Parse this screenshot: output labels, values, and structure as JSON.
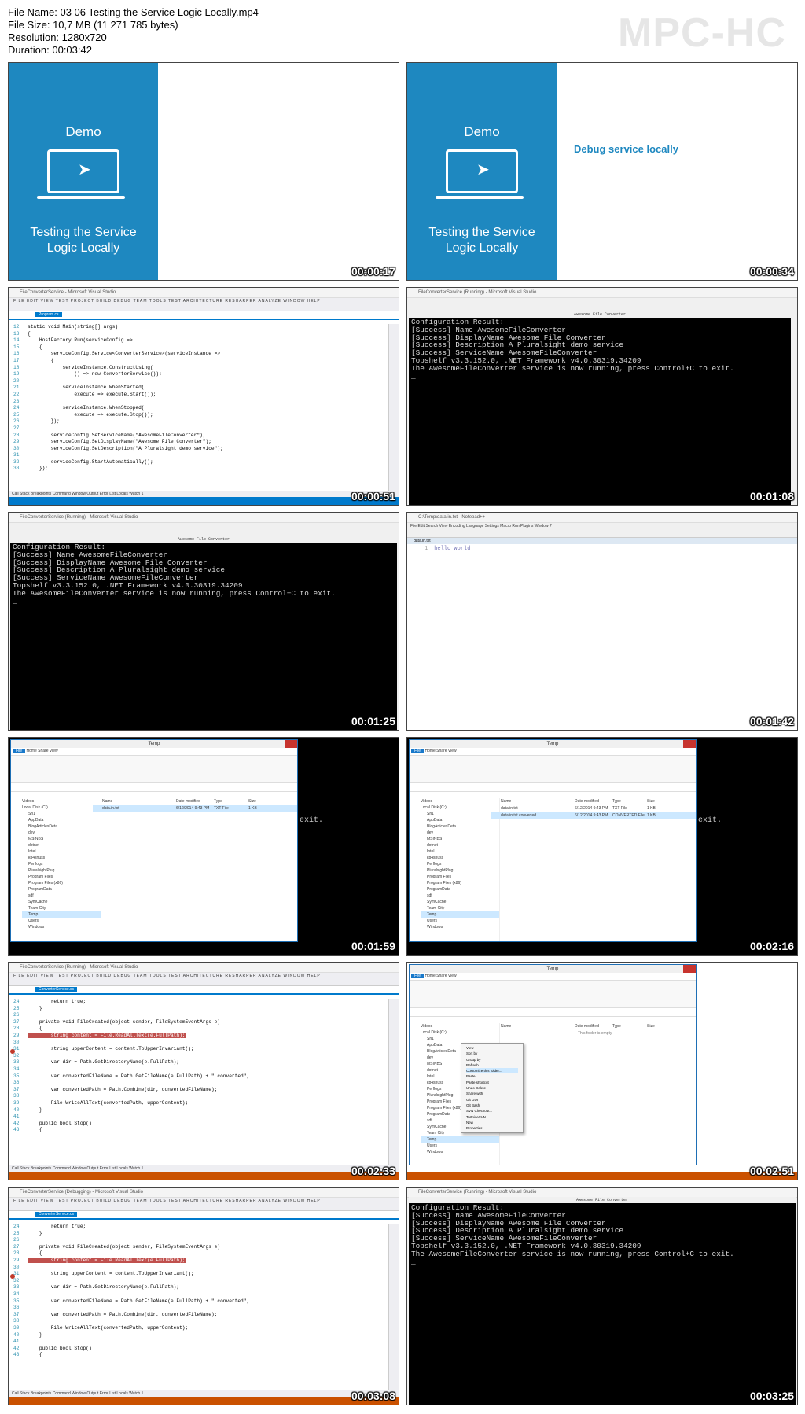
{
  "header": {
    "file_name": "File Name: 03 06 Testing the Service Logic Locally.mp4",
    "file_size": "File Size: 10,7 MB (11 271 785 bytes)",
    "resolution": "Resolution: 1280x720",
    "duration": "Duration: 00:03:42",
    "logo": "MPC-HC"
  },
  "slide": {
    "demo_label": "Demo",
    "title_line1": "Testing the Service",
    "title_line2": "Logic Locally",
    "subtitle": "Debug service locally"
  },
  "timestamps": [
    "00:00:17",
    "00:00:34",
    "00:00:51",
    "00:01:08",
    "00:01:25",
    "00:01:42",
    "00:01:59",
    "00:02:16",
    "00:02:33",
    "00:02:51",
    "00:03:08",
    "00:03:25"
  ],
  "vs": {
    "title": "FileConverterService - Microsoft Visual Studio",
    "title_running": "FileConverterService (Running) - Microsoft Visual Studio",
    "title_debugging": "FileConverterService (Debugging) - Microsoft Visual Studio",
    "menu": "FILE  EDIT  VIEW  TEST  PROJECT  BUILD  DEBUG  TEAM  TOOLS  TEST  ARCHITECTURE  RESHARPER  ANALYZE  WINDOW  HELP",
    "tab_program": "Program.cs",
    "tab_converter": "ConverterService.cs",
    "panel_tabs": "Call Stack  Breakpoints  Command Window  Output  Error List  Locals  Watch 1",
    "program_lines": [
      {
        "n": "12",
        "t": "static void Main(string[] args)"
      },
      {
        "n": "13",
        "t": "{"
      },
      {
        "n": "14",
        "t": "    HostFactory.Run(serviceConfig =>"
      },
      {
        "n": "15",
        "t": "    {"
      },
      {
        "n": "16",
        "t": "        serviceConfig.Service<ConverterService>(serviceInstance =>"
      },
      {
        "n": "17",
        "t": "        {"
      },
      {
        "n": "18",
        "t": "            serviceInstance.ConstructUsing("
      },
      {
        "n": "19",
        "t": "                () => new ConverterService());"
      },
      {
        "n": "20",
        "t": ""
      },
      {
        "n": "21",
        "t": "            serviceInstance.WhenStarted("
      },
      {
        "n": "22",
        "t": "                execute => execute.Start());"
      },
      {
        "n": "23",
        "t": ""
      },
      {
        "n": "24",
        "t": "            serviceInstance.WhenStopped("
      },
      {
        "n": "25",
        "t": "                execute => execute.Stop());"
      },
      {
        "n": "26",
        "t": "        });"
      },
      {
        "n": "27",
        "t": ""
      },
      {
        "n": "28",
        "t": "        serviceConfig.SetServiceName(\"AwesomeFileConverter\");"
      },
      {
        "n": "29",
        "t": "        serviceConfig.SetDisplayName(\"Awesome File Converter\");"
      },
      {
        "n": "30",
        "t": "        serviceConfig.SetDescription(\"A Pluralsight demo service\");"
      },
      {
        "n": "31",
        "t": ""
      },
      {
        "n": "32",
        "t": "        serviceConfig.StartAutomatically();"
      },
      {
        "n": "33",
        "t": "    });"
      }
    ],
    "converter_lines": [
      {
        "n": "24",
        "t": "        return true;"
      },
      {
        "n": "25",
        "t": "    }"
      },
      {
        "n": "26",
        "t": ""
      },
      {
        "n": "27",
        "t": "    private void FileCreated(object sender, FileSystemEventArgs e)"
      },
      {
        "n": "28",
        "t": "    {"
      },
      {
        "n": "29",
        "t": "        string content = File.ReadAllText(e.FullPath);"
      },
      {
        "n": "30",
        "t": ""
      },
      {
        "n": "31",
        "t": "        string upperContent = content.ToUpperInvariant();"
      },
      {
        "n": "32",
        "t": ""
      },
      {
        "n": "33",
        "t": "        var dir = Path.GetDirectoryName(e.FullPath);"
      },
      {
        "n": "34",
        "t": ""
      },
      {
        "n": "35",
        "t": "        var convertedFileName = Path.GetFileName(e.FullPath) + \".converted\";"
      },
      {
        "n": "36",
        "t": ""
      },
      {
        "n": "37",
        "t": "        var convertedPath = Path.Combine(dir, convertedFileName);"
      },
      {
        "n": "38",
        "t": ""
      },
      {
        "n": "39",
        "t": "        File.WriteAllText(convertedPath, upperContent);"
      },
      {
        "n": "40",
        "t": "    }"
      },
      {
        "n": "41",
        "t": ""
      },
      {
        "n": "42",
        "t": "    public bool Stop()"
      },
      {
        "n": "43",
        "t": "    {"
      }
    ]
  },
  "console": {
    "title": "Awesome File Converter",
    "lines": [
      "Configuration Result:",
      "[Success] Name AwesomeFileConverter",
      "[Success] DisplayName Awesome File Converter",
      "[Success] Description A Pluralsight demo service",
      "[Success] ServiceName AwesomeFileConverter",
      "Topshelf v3.3.152.0, .NET Framework v4.0.30319.34209",
      "The AwesomeFileConverter service is now running, press Control+C to exit."
    ],
    "exit_fragment": "exit."
  },
  "notepad": {
    "title": "C:\\Temp\\data.in.txt - Notepad++",
    "menu": "File  Edit  Search  View  Encoding  Language  Settings  Macro  Run  Plugins  Window  ?",
    "tab": "data.in.txt",
    "line_no": "1",
    "text": "hello world"
  },
  "explorer": {
    "title": "Temp",
    "tab_file": "File",
    "tabs": "Home  Share  View",
    "tree": [
      "Videos",
      "Local Disk (C:)",
      "Sn1",
      "AppData",
      "BlogArticlesDeta",
      "dev",
      "MSINBS",
      "dotnet",
      "Intel",
      "kb4shuss",
      "Perflogs",
      "PluralsightPlug",
      "Program Files",
      "Program Files (x86)",
      "ProgramData",
      "sdf",
      "SymCache",
      "Team City",
      "Temp",
      "Users",
      "Windows"
    ],
    "col_name": "Name",
    "col_date": "Date modified",
    "col_type": "Type",
    "col_size": "Size",
    "file_in": "data.in.txt",
    "file_converted": "data.in.txt.converted",
    "date": "6/12/2014 9:43 PM",
    "type_txt": "TXT File",
    "type_conv": "CONVERTED File",
    "size": "1 KB",
    "empty": "This folder is empty."
  },
  "context_menu": [
    "View",
    "Sort by",
    "Group by",
    "Refresh",
    "Customize this folder...",
    "Paste",
    "Paste shortcut",
    "Undo Delete",
    "Share with",
    "Git GUI",
    "Git Bash",
    "SVN Checkout...",
    "TortoiseSVN",
    "New",
    "Properties"
  ]
}
